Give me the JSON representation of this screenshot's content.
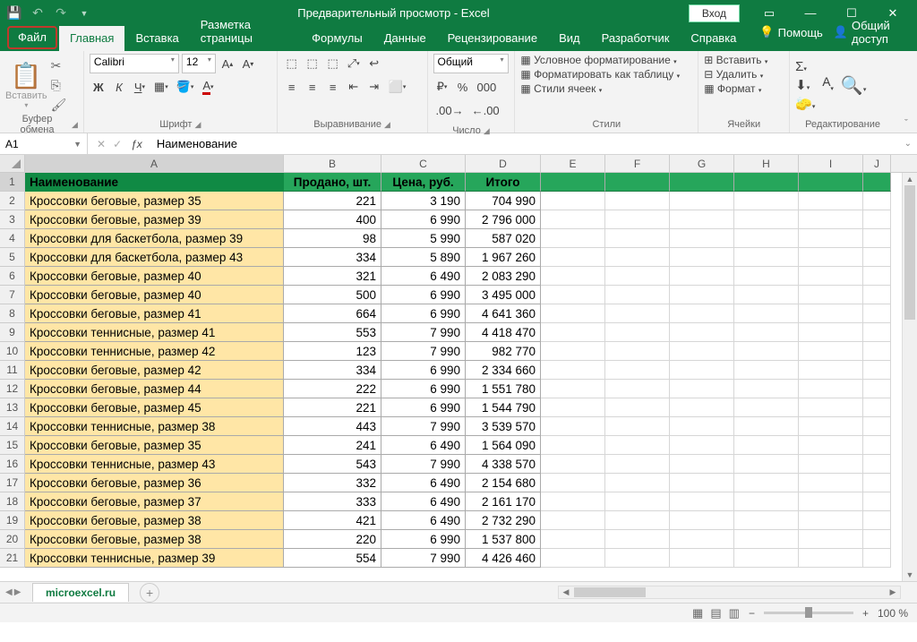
{
  "title": "Предварительный просмотр  -  Excel",
  "login": "Вход",
  "tabs": {
    "file": "Файл",
    "items": [
      "Главная",
      "Вставка",
      "Разметка страницы",
      "Формулы",
      "Данные",
      "Рецензирование",
      "Вид",
      "Разработчик",
      "Справка"
    ],
    "help": "Помощь",
    "share": "Общий доступ"
  },
  "ribbon": {
    "clipboard": {
      "paste": "Вставить",
      "label": "Буфер обмена"
    },
    "font": {
      "name": "Calibri",
      "size": "12",
      "label": "Шрифт"
    },
    "align": {
      "label": "Выравнивание"
    },
    "number": {
      "format": "Общий",
      "label": "Число"
    },
    "styles": {
      "cond": "Условное форматирование",
      "table": "Форматировать как таблицу",
      "cell": "Стили ячеек",
      "label": "Стили"
    },
    "cells": {
      "insert": "Вставить",
      "delete": "Удалить",
      "format": "Формат",
      "label": "Ячейки"
    },
    "editing": {
      "label": "Редактирование"
    }
  },
  "nameBox": "A1",
  "formulaText": "Наименование",
  "columns": [
    "A",
    "B",
    "C",
    "D",
    "E",
    "F",
    "G",
    "H",
    "I",
    "J"
  ],
  "headers": [
    "Наименование",
    "Продано, шт.",
    "Цена, руб.",
    "Итого"
  ],
  "rows": [
    [
      "Кроссовки беговые, размер 35",
      "221",
      "3 190",
      "704 990"
    ],
    [
      "Кроссовки беговые, размер 39",
      "400",
      "6 990",
      "2 796 000"
    ],
    [
      "Кроссовки для баскетбола, размер 39",
      "98",
      "5 990",
      "587 020"
    ],
    [
      "Кроссовки для баскетбола, размер 43",
      "334",
      "5 890",
      "1 967 260"
    ],
    [
      "Кроссовки беговые, размер 40",
      "321",
      "6 490",
      "2 083 290"
    ],
    [
      "Кроссовки беговые, размер 40",
      "500",
      "6 990",
      "3 495 000"
    ],
    [
      "Кроссовки беговые, размер 41",
      "664",
      "6 990",
      "4 641 360"
    ],
    [
      "Кроссовки теннисные, размер 41",
      "553",
      "7 990",
      "4 418 470"
    ],
    [
      "Кроссовки теннисные, размер 42",
      "123",
      "7 990",
      "982 770"
    ],
    [
      "Кроссовки беговые, размер 42",
      "334",
      "6 990",
      "2 334 660"
    ],
    [
      "Кроссовки беговые, размер 44",
      "222",
      "6 990",
      "1 551 780"
    ],
    [
      "Кроссовки беговые, размер 45",
      "221",
      "6 990",
      "1 544 790"
    ],
    [
      "Кроссовки теннисные, размер 38",
      "443",
      "7 990",
      "3 539 570"
    ],
    [
      "Кроссовки беговые, размер 35",
      "241",
      "6 490",
      "1 564 090"
    ],
    [
      "Кроссовки теннисные, размер 43",
      "543",
      "7 990",
      "4 338 570"
    ],
    [
      "Кроссовки беговые, размер 36",
      "332",
      "6 490",
      "2 154 680"
    ],
    [
      "Кроссовки беговые, размер 37",
      "333",
      "6 490",
      "2 161 170"
    ],
    [
      "Кроссовки беговые, размер 38",
      "421",
      "6 490",
      "2 732 290"
    ],
    [
      "Кроссовки беговые, размер 38",
      "220",
      "6 990",
      "1 537 800"
    ],
    [
      "Кроссовки теннисные, размер 39",
      "554",
      "7 990",
      "4 426 460"
    ]
  ],
  "sheet": "microexcel.ru",
  "zoom": "100 %"
}
